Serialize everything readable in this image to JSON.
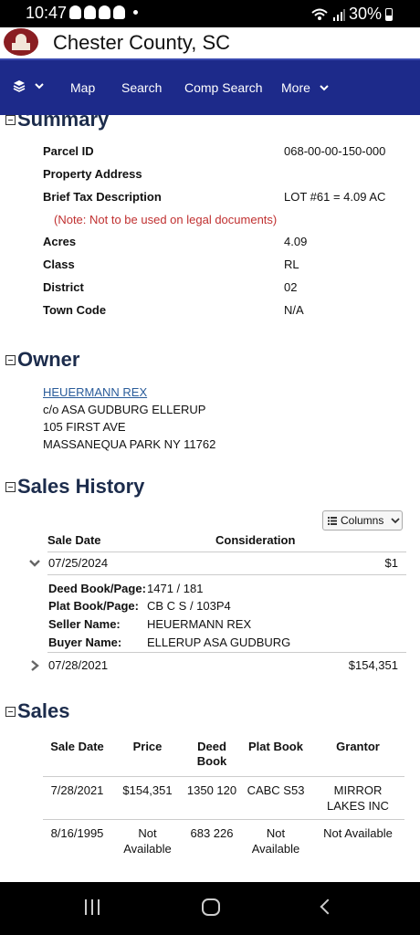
{
  "status_bar": {
    "time": "10:47",
    "battery": "30%"
  },
  "header": {
    "title": "Chester County, SC"
  },
  "nav": {
    "items": [
      "Map",
      "Search",
      "Comp Search",
      "More"
    ]
  },
  "summary": {
    "title": "Summary",
    "rows": [
      {
        "label": "Parcel ID",
        "value": "068-00-00-150-000"
      },
      {
        "label": "Property Address",
        "value": ""
      },
      {
        "label": "Brief Tax Description",
        "value": "LOT #61 = 4.09 AC"
      },
      {
        "label": "Acres",
        "value": "4.09"
      },
      {
        "label": "Class",
        "value": "RL"
      },
      {
        "label": "District",
        "value": "02"
      },
      {
        "label": "Town Code",
        "value": "N/A"
      }
    ],
    "note": "(Note: Not to be used on legal documents)"
  },
  "owner": {
    "title": "Owner",
    "name": "HEUERMANN REX",
    "care_of": "c/o ASA GUDBURG ELLERUP",
    "address1": "105 FIRST AVE",
    "address2": "MASSANEQUA PARK NY 11762"
  },
  "sales_history": {
    "title": "Sales History",
    "columns_button": "Columns",
    "headers": {
      "date": "Sale Date",
      "consideration": "Consideration"
    },
    "rows": [
      {
        "date": "07/25/2024",
        "amount": "$1"
      },
      {
        "date": "07/28/2021",
        "amount": "$154,351"
      }
    ],
    "details": [
      {
        "label": "Deed Book/Page:",
        "value": "1471 / 181"
      },
      {
        "label": "Plat Book/Page:",
        "value": "CB C S / 103P4"
      },
      {
        "label": "Seller Name:",
        "value": "HEUERMANN REX"
      },
      {
        "label": "Buyer Name:",
        "value": "ELLERUP ASA GUDBURG"
      }
    ]
  },
  "sales": {
    "title": "Sales",
    "headers": {
      "date": "Sale Date",
      "price": "Price",
      "deed": "Deed Book",
      "plat": "Plat Book",
      "grantor": "Grantor"
    },
    "rows": [
      {
        "date": "7/28/2021",
        "price": "$154,351",
        "deed": "1350 120",
        "plat": "CABC S53",
        "grantor": "MIRROR LAKES INC"
      },
      {
        "date": "8/16/1995",
        "price": "Not Available",
        "deed": "683 226",
        "plat": "Not Available",
        "grantor": "Not Available"
      }
    ]
  }
}
